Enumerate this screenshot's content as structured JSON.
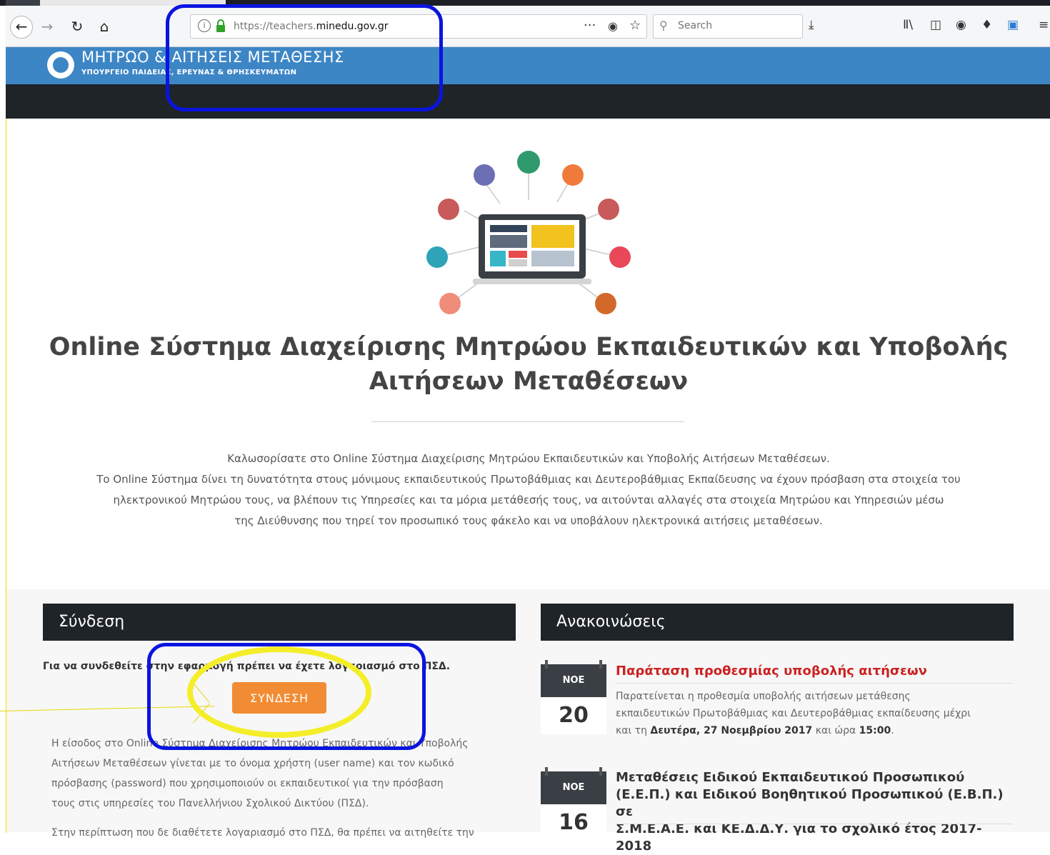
{
  "browser": {
    "url_prefix": "https://teachers.",
    "url_domain": "minedu.gov.gr",
    "search_placeholder": "Search",
    "menu_dots": "···"
  },
  "header": {
    "title": "ΜΗΤΡΩΟ & ΑΙΤΗΣΕΙΣ ΜΕΤΑΘΕΣΗΣ",
    "subtitle": "ΥΠΟΥΡΓΕΙΟ ΠΑΙΔΕΙΑΣ, ΕΡΕΥΝΑΣ & ΘΡΗΣΚΕΥΜΑΤΩΝ"
  },
  "hero": {
    "title_line1": "Online Σύστημα Διαχείρισης Μητρώου Εκπαιδευτικών και Υποβολής",
    "title_line2": "Αιτήσεων Μεταθέσεων",
    "intro_line1": "Καλωσορίσατε στο Online Σύστημα Διαχείρισης Μητρώου Εκπαιδευτικών και Υποβολής Αιτήσεων Μεταθέσεων.",
    "intro_line2": "Το Online Σύστημα δίνει τη δυνατότητα στους μόνιμους εκπαιδευτικούς Πρωτοβάθμιας και Δευτεροβάθμιας Εκπαίδευσης να έχουν πρόσβαση στα στοιχεία του",
    "intro_line3": "ηλεκτρονικού Μητρώου τους, να βλέπουν τις Υπηρεσίες και τα μόρια μετάθεσής τους, να αιτούνται αλλαγές στα στοιχεία Μητρώου και Υπηρεσιών μέσω",
    "intro_line4": "της Διεύθυνσης που τηρεί τον προσωπικό τους φάκελο και να υποβάλουν ηλεκτρονικά αιτήσεις μεταθέσεων."
  },
  "login": {
    "heading": "Σύνδεση",
    "note": "Για να συνδεθείτε στην εφαρμογή πρέπει να έχετε λογαριασμό στο ΠΣΔ.",
    "button": "ΣΥΝΔΕΣΗ",
    "text_line1": "Η είσοδος στο Online Σύστημα Διαχείρισης Μητρώου Εκπαιδευτικών και Υποβολής",
    "text_line2": "Αιτήσεων Μεταθέσεων γίνεται με το όνομα χρήστη (user name) και τον κωδικό",
    "text_line3": "πρόσβασης (password) που χρησιμοποιούν οι εκπαιδευτικοί για την πρόσβαση",
    "text_line4": "τους στις υπηρεσίες του Πανελλήνιου Σχολικού Δικτύου (ΠΣΔ).",
    "text_line5": "Στην περίπτωση που δε διαθέτετε λογαριασμό στο ΠΣΔ, θα πρέπει να αιτηθείτε την"
  },
  "news": {
    "heading": "Ανακοινώσεις",
    "items": [
      {
        "month": "ΝΟΕ",
        "day": "20",
        "title": "Παράταση προθεσμίας υποβολής αιτήσεων",
        "body_line1": "Παρατείνεται η προθεσμία υποβολής αιτήσεων μετάθεσης",
        "body_line2": "εκπαιδευτικών Πρωτοβάθμιας και Δευτεροβάθμιας εκπαίδευσης μέχρι",
        "body_pre": "και τη ",
        "body_date": "Δευτέρα, 27 Νοεμβρίου 2017",
        "body_mid": " και ώρα ",
        "body_time": "15:00",
        "body_end": "."
      },
      {
        "month": "ΝΟΕ",
        "day": "16",
        "title_line1": "Μεταθέσεις Ειδικού Εκπαιδευτικού Προσωπικού",
        "title_line2": "(Ε.Ε.Π.) και Ειδικού Βοηθητικού Προσωπικού (Ε.Β.Π.) σε",
        "title_line3": "Σ.Μ.Ε.Α.Ε. και ΚΕ.Δ.Δ.Υ. για το σχολικό έτος 2017-2018"
      }
    ]
  },
  "colors": {
    "header_blue": "#3d86c6",
    "dark_bar": "#1f2428",
    "login_orange": "#f28c34",
    "news_red": "#cc2222",
    "annotation_blue": "#0a14e0",
    "annotation_yellow": "#f4ee2a"
  },
  "icons": [
    "back-arrow-icon",
    "forward-arrow-icon",
    "reload-icon",
    "home-icon",
    "info-icon",
    "lock-icon",
    "pocket-icon",
    "bookmark-star-icon",
    "search-icon",
    "download-icon",
    "library-icon",
    "sidebar-icon",
    "extension-icon",
    "menu-icon"
  ]
}
